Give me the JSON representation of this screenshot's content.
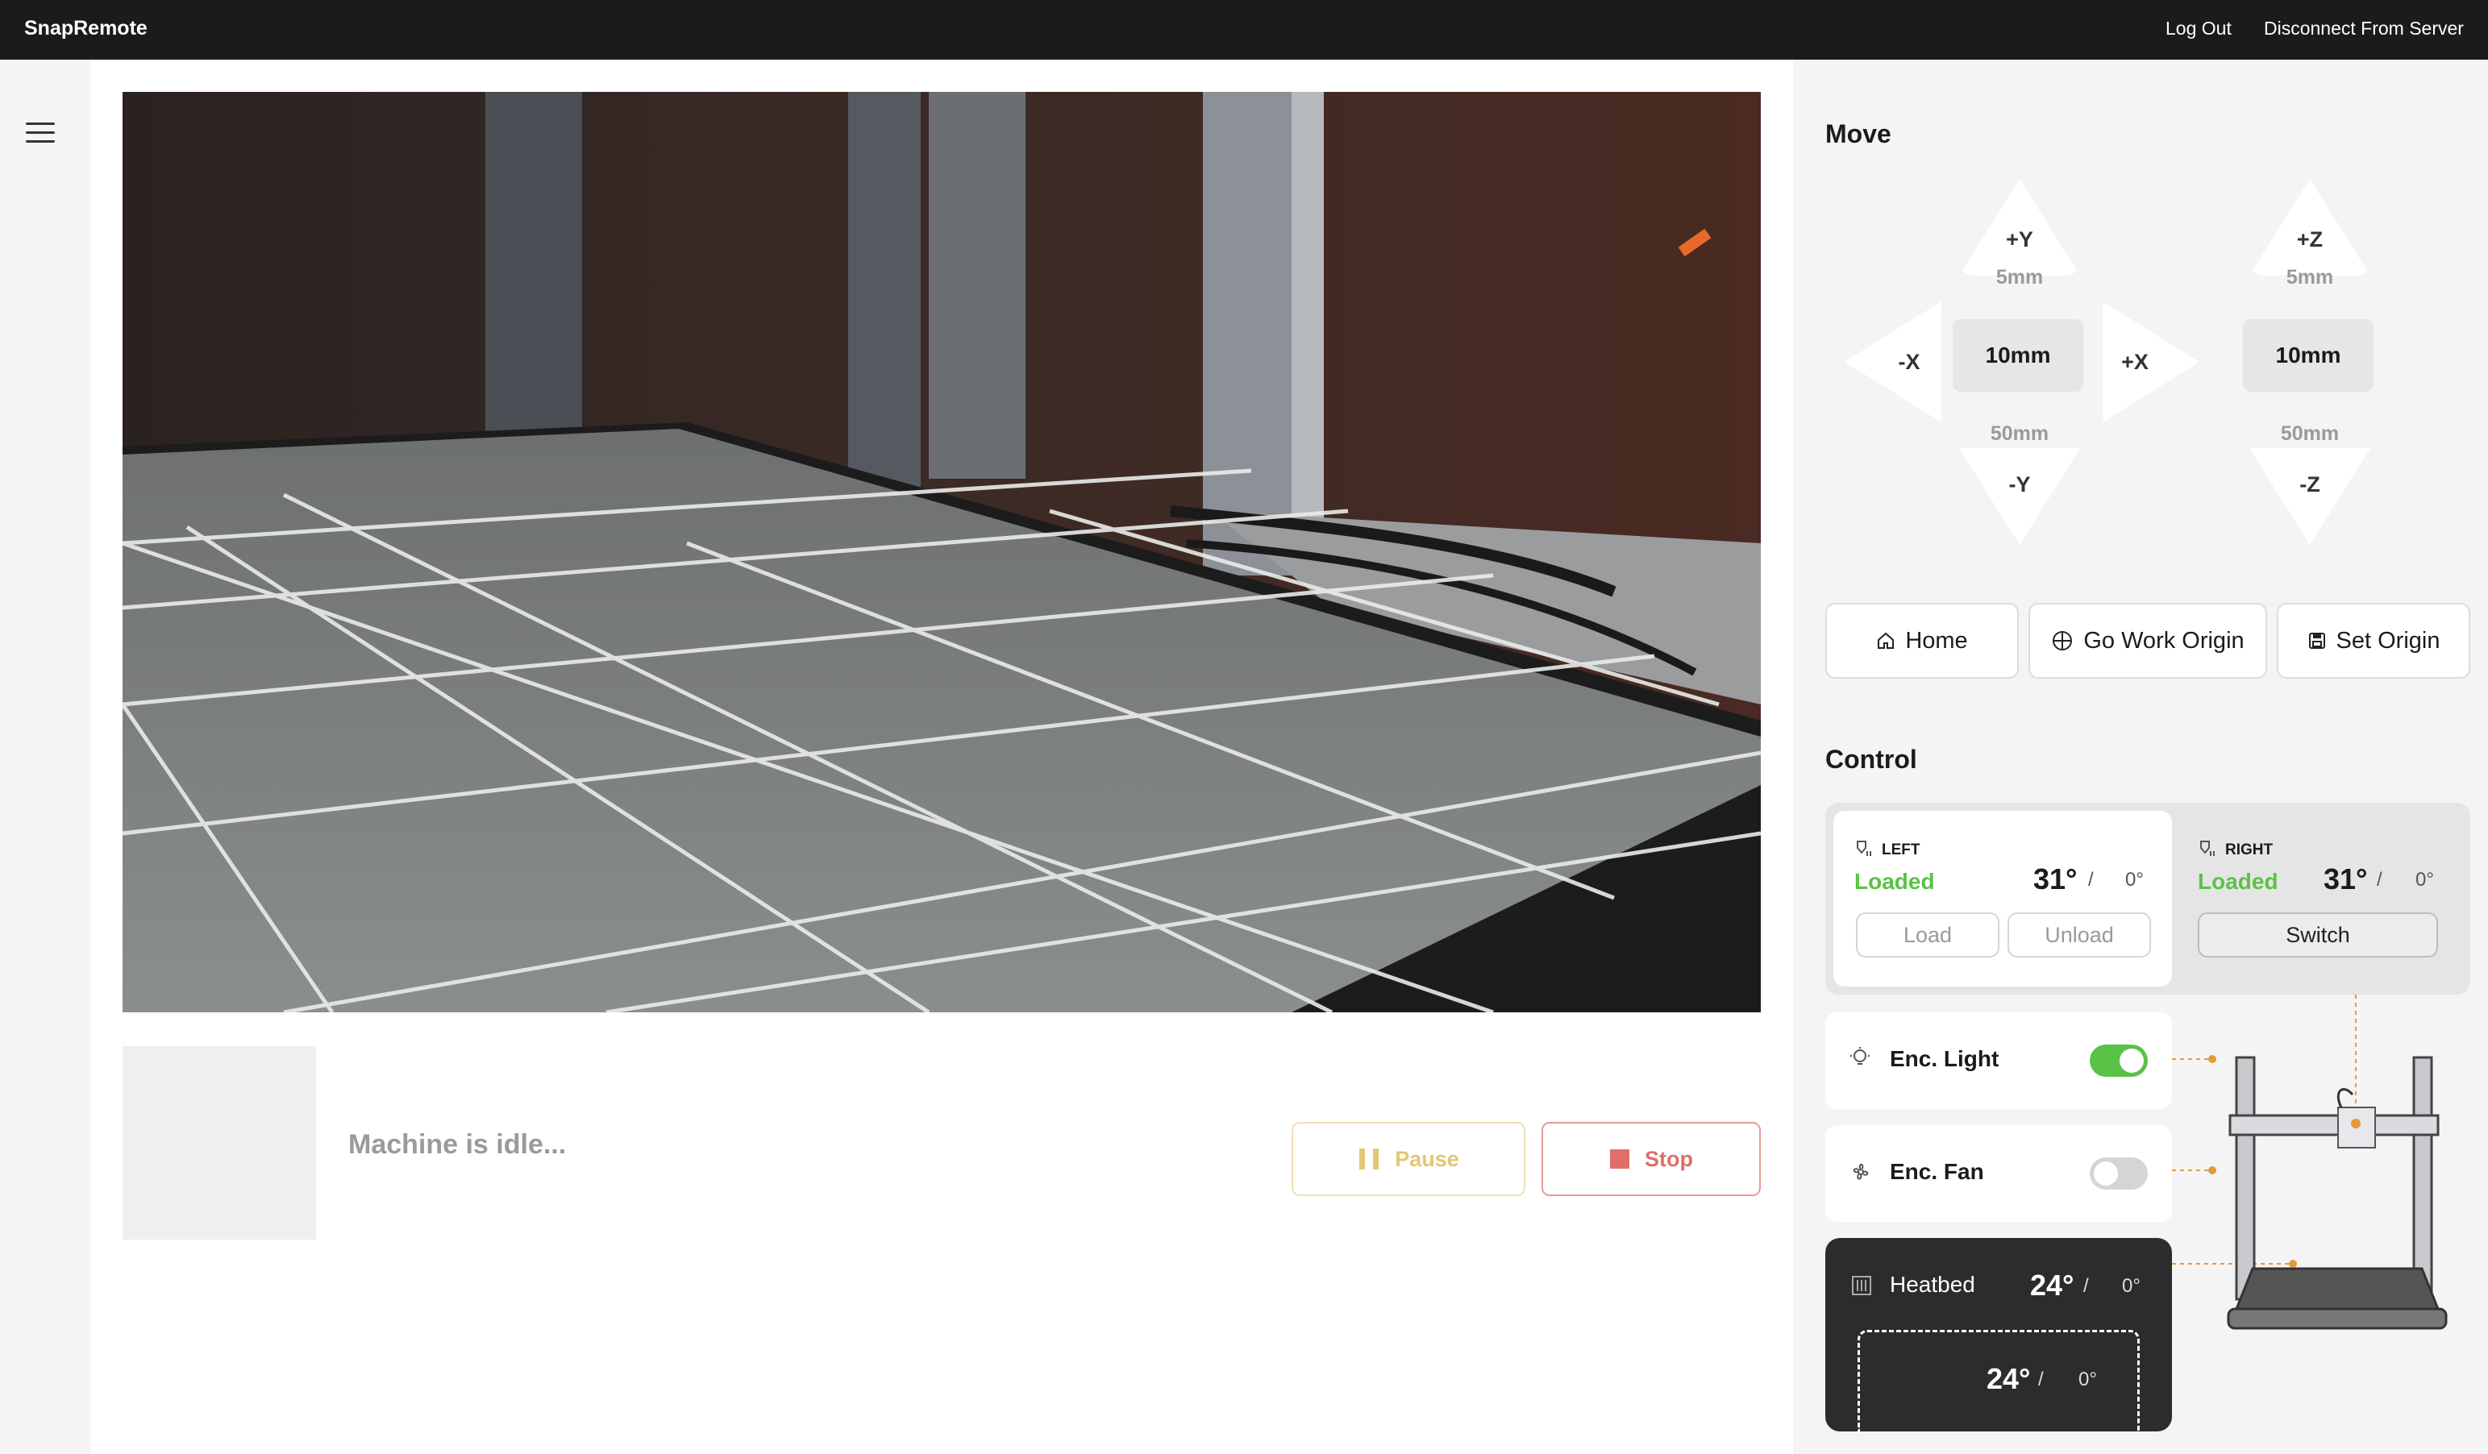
{
  "app": {
    "title": "SnapRemote",
    "logout": "Log Out",
    "disconnect": "Disconnect From Server"
  },
  "sidebar": {
    "menu_icon": "hamburger-menu-icon"
  },
  "main": {
    "status_text": "Machine is idle...",
    "pause_label": "Pause",
    "stop_label": "Stop"
  },
  "move": {
    "title": "Move",
    "plus_y": "+Y",
    "minus_y": "-Y",
    "plus_x": "+X",
    "minus_x": "-X",
    "plus_z": "+Z",
    "minus_z": "-Z",
    "step_small": "5mm",
    "step_mid": "10mm",
    "step_large": "50mm",
    "z_step_small": "5mm",
    "z_step_mid": "10mm",
    "z_step_large": "50mm",
    "home": "Home",
    "go_work_origin": "Go Work Origin",
    "set_origin": "Set Origin"
  },
  "control": {
    "title": "Control",
    "left": {
      "label": "LEFT",
      "status": "Loaded",
      "temp": "31°",
      "sep": "/",
      "target": "0°",
      "load": "Load",
      "unload": "Unload"
    },
    "right": {
      "label": "RIGHT",
      "status": "Loaded",
      "temp": "31°",
      "sep": "/",
      "target": "0°",
      "switch": "Switch"
    },
    "light": {
      "label": "Enc. Light",
      "on": true
    },
    "fan": {
      "label": "Enc. Fan",
      "on": false
    },
    "heatbed": {
      "label": "Heatbed",
      "temp": "24°",
      "sep": "/",
      "target": "0°",
      "zone_temp": "24°",
      "zone_sep": "/",
      "zone_target": "0°"
    }
  },
  "colors": {
    "accent_green": "#5ac247",
    "topbar": "#1b1b1b",
    "stop_red": "#e16e69",
    "pause_gold": "#e1c777",
    "callout_orange": "#e39a3b"
  }
}
